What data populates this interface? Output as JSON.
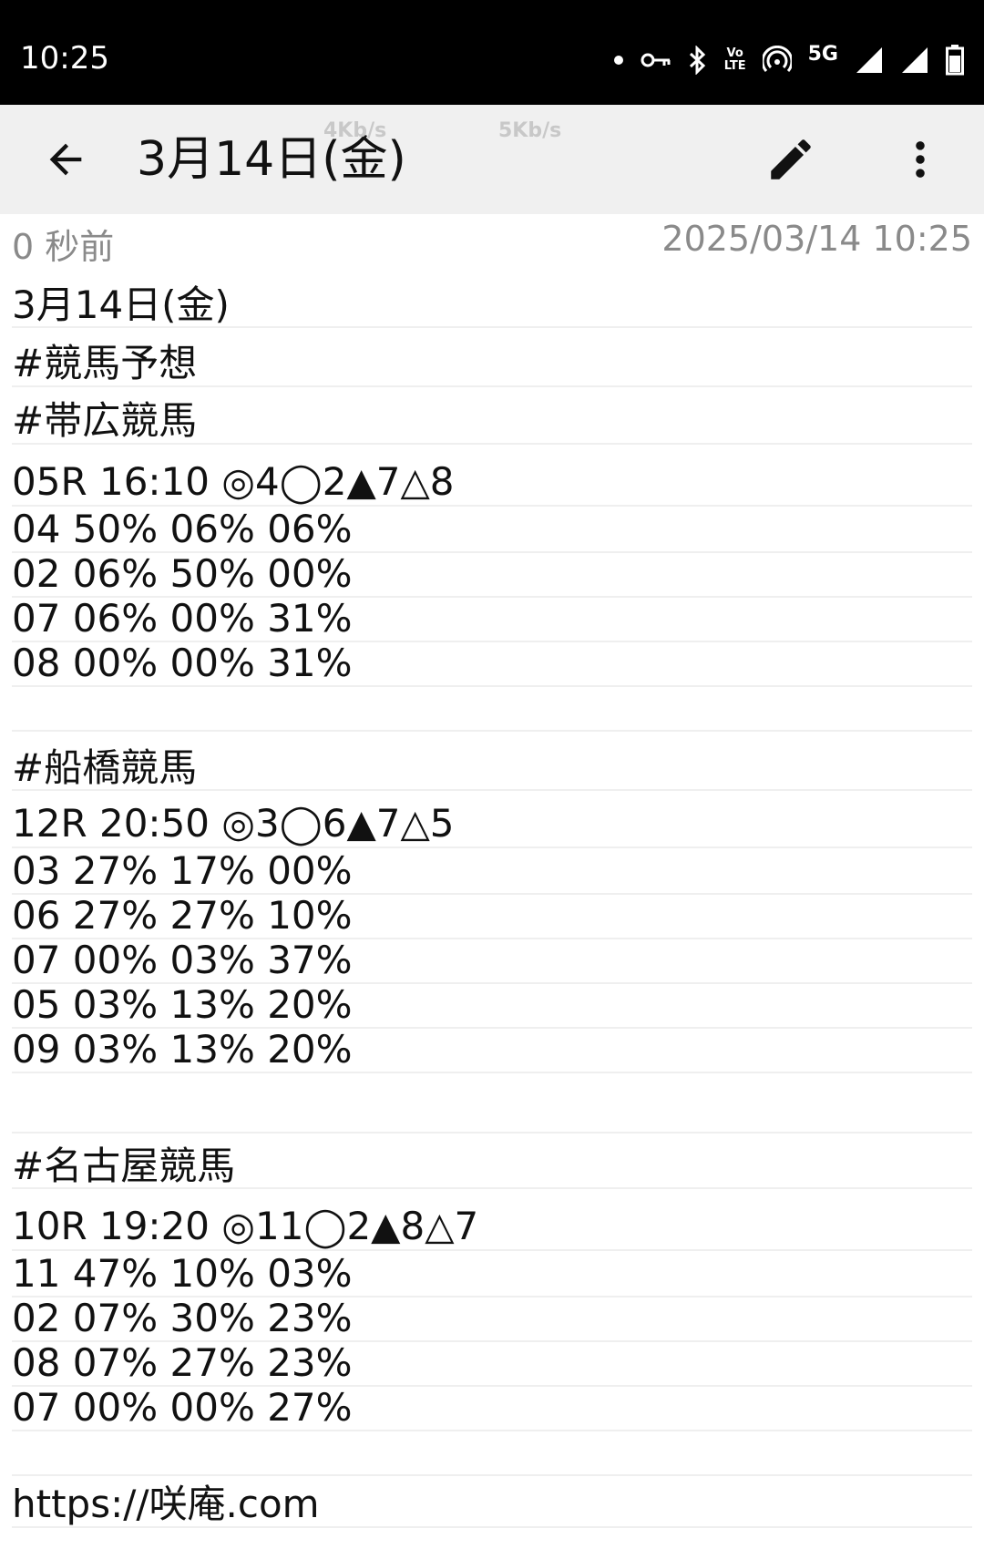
{
  "status_bar": {
    "time": "10:25",
    "network": "5G",
    "icons": [
      "dot-icon",
      "vpn-key-icon",
      "bluetooth-icon",
      "volte-icon",
      "hotspot-icon",
      "signal-icon",
      "signal-icon",
      "battery-icon"
    ],
    "volte_label_1": "Vo",
    "volte_label_2": "LTE"
  },
  "toolbar": {
    "title": "3月14日(金)",
    "speed_up": "4Kb/s",
    "speed_down": "5Kb/s"
  },
  "meta": {
    "relative_time": "0 秒前",
    "timestamp": "2025/03/14 10:25"
  },
  "note": {
    "lines": [
      "3月14日(金)",
      "#競馬予想",
      "#帯広競馬",
      "05R 16:10 ◎4◯2▲7△8",
      "04 50% 06% 06%",
      "02 06% 50% 00%",
      "07 06% 00% 31%",
      "08 00% 00% 31%",
      "",
      "#船橋競馬",
      "12R 20:50 ◎3◯6▲7△5",
      "03 27% 17% 00%",
      "06 27% 27% 10%",
      "07 00% 03% 37%",
      "05 03% 13% 20%",
      "09 03% 13% 20%",
      "",
      "#名古屋競馬",
      "10R 19:20 ◎11◯2▲8△7",
      "11 47% 10% 03%",
      "02 07% 30% 23%",
      "08 07% 27% 23%",
      "07 00% 00% 27%",
      "",
      "https://咲庵.com"
    ]
  }
}
